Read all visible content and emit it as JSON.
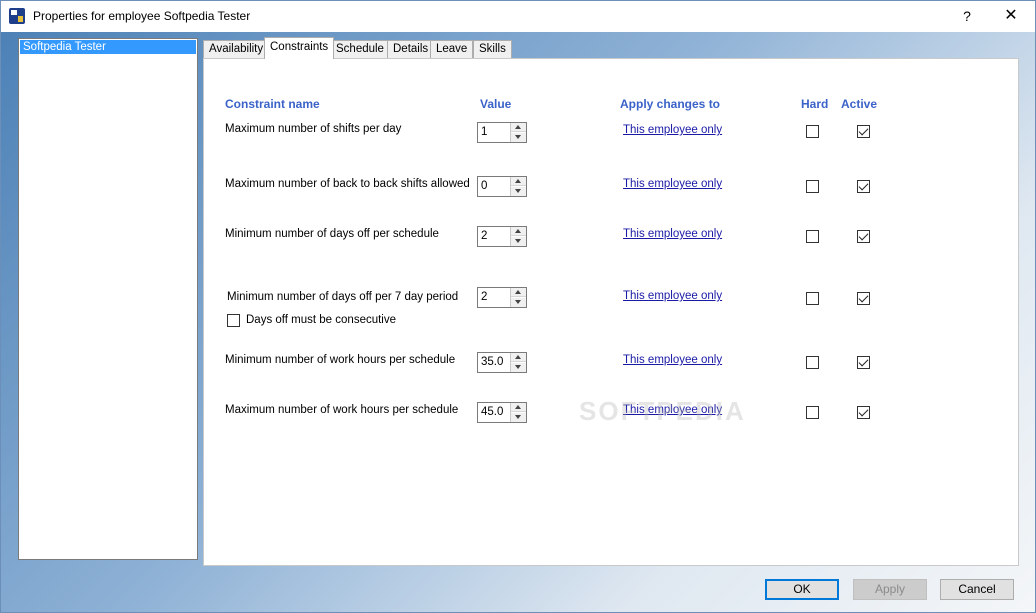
{
  "window": {
    "title": "Properties for employee Softpedia Tester",
    "help_label": "?",
    "close_label": "✕"
  },
  "employee_list": {
    "items": [
      "Softpedia Tester"
    ]
  },
  "tabs": [
    {
      "label": "Availability",
      "active": false
    },
    {
      "label": "Constraints",
      "active": true
    },
    {
      "label": "Schedule",
      "active": false
    },
    {
      "label": "Details",
      "active": false
    },
    {
      "label": "Leave",
      "active": false
    },
    {
      "label": "Skills",
      "active": false
    }
  ],
  "constraints": {
    "headers": {
      "name": "Constraint name",
      "value": "Value",
      "apply": "Apply changes to",
      "hard": "Hard",
      "active": "Active"
    },
    "rows": [
      {
        "name": "Maximum number of shifts per day",
        "value": "1",
        "apply": "This employee only",
        "hard": false,
        "active": true
      },
      {
        "name": "Maximum number of back to back shifts allowed",
        "value": "0",
        "apply": "This employee only",
        "hard": false,
        "active": true
      },
      {
        "name": "Minimum number of days off per schedule",
        "value": "2",
        "apply": "This employee only",
        "hard": false,
        "active": true
      },
      {
        "name": "Minimum number of days off per 7 day period",
        "value": "2",
        "apply": "This employee only",
        "hard": false,
        "active": true
      },
      {
        "name": "Minimum number of work hours per schedule",
        "value": "35.0",
        "apply": "This employee only",
        "hard": false,
        "active": true
      },
      {
        "name": "Maximum number of work hours per schedule",
        "value": "45.0",
        "apply": "This employee only",
        "hard": false,
        "active": true
      }
    ],
    "consecutive_option": {
      "label": "Days off must be consecutive",
      "checked": false
    }
  },
  "watermark": "SOFTPEDIA",
  "buttons": {
    "ok": "OK",
    "apply": "Apply",
    "cancel": "Cancel"
  },
  "icons": {
    "app": "app-icon",
    "spin_up": "arrow-up-icon",
    "spin_down": "arrow-down-icon"
  }
}
